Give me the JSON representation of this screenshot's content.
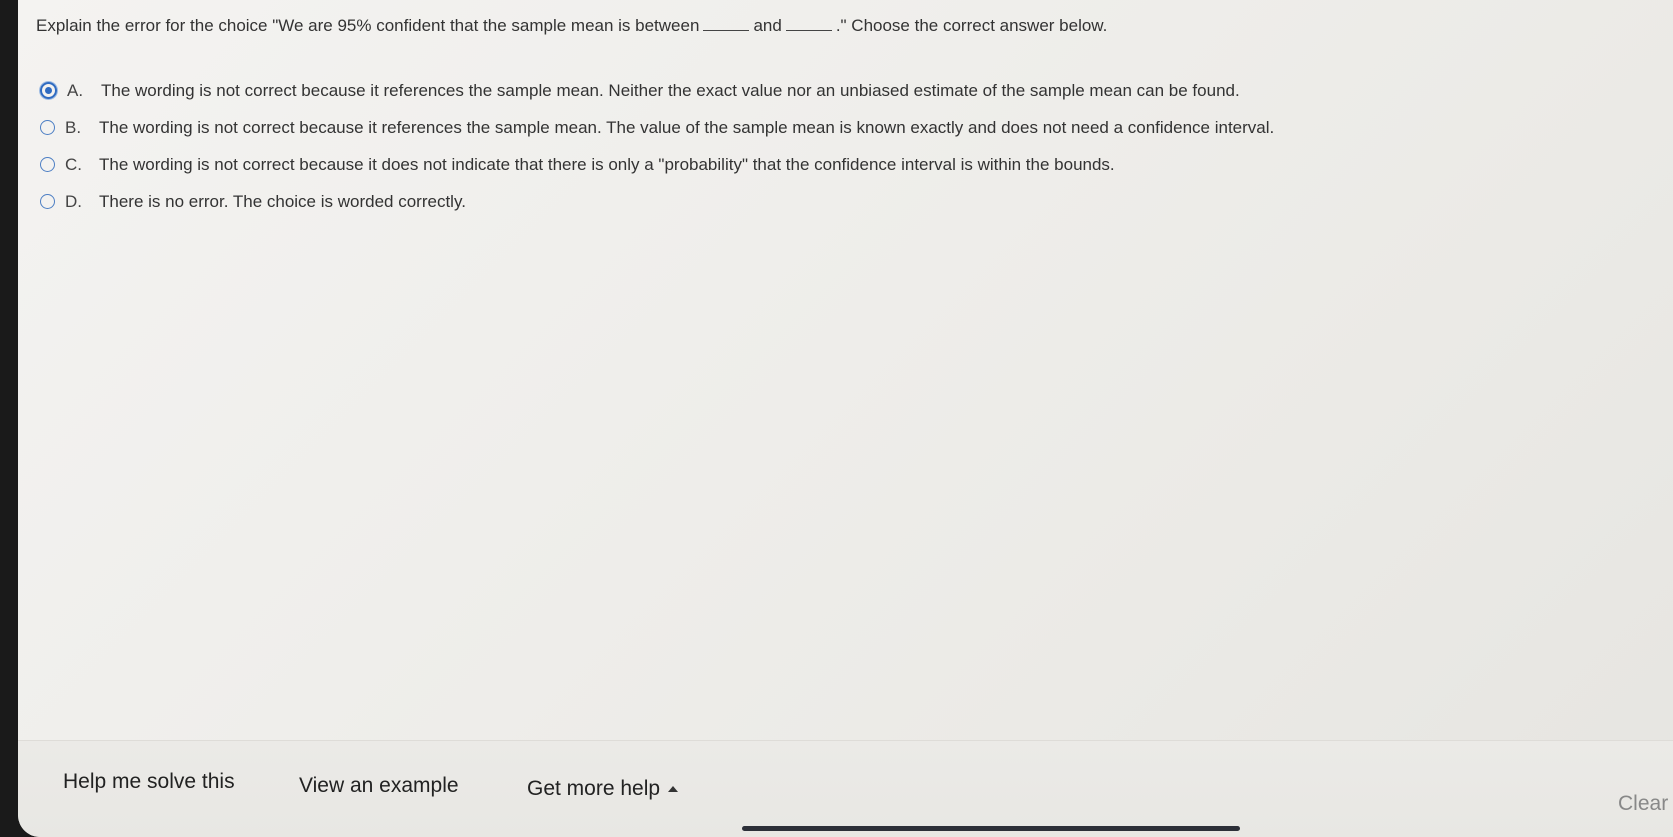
{
  "question": {
    "part1": "Explain the error for the choice \"We are 95% confident that the sample mean is between",
    "part2": "and",
    "part3": ".\" Choose the correct answer below."
  },
  "choices": [
    {
      "letter": "A.",
      "text": "The wording is not correct because it references the sample mean. Neither the exact value nor an unbiased estimate of the sample mean can be found.",
      "selected": true
    },
    {
      "letter": "B.",
      "text": "The wording is not correct because it references the sample mean. The value of the sample mean is known exactly and does not need a confidence interval.",
      "selected": false
    },
    {
      "letter": "C.",
      "text": "The wording is not correct because it does not indicate that there is only a \"probability\" that the confidence interval is within the bounds.",
      "selected": false
    },
    {
      "letter": "D.",
      "text": "There is no error. The choice is worded correctly.",
      "selected": false
    }
  ],
  "footer": {
    "help_me_solve": "Help me solve this",
    "view_example": "View an example",
    "get_more_help": "Get more help",
    "clear": "Clear"
  },
  "colors": {
    "radio_accent": "#2f6bc1"
  }
}
